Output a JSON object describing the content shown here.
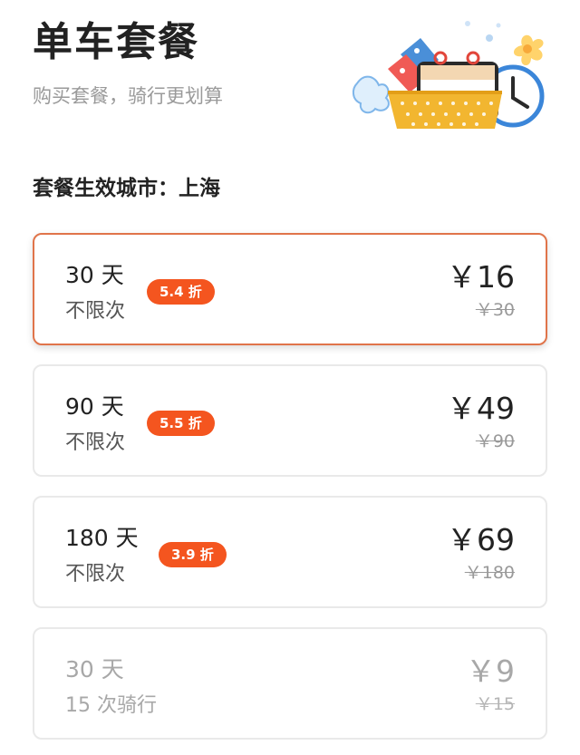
{
  "header": {
    "title": "单车套餐",
    "subtitle": "购买套餐，骑行更划算"
  },
  "hero": {
    "icon": "shopping-basket-calendar-clock-illustration"
  },
  "city": {
    "label": "套餐生效城市：上海"
  },
  "plans": [
    {
      "days": "30 天",
      "limit": "不限次",
      "discount": "5.4 折",
      "price": "￥16",
      "original_price": "￥30",
      "selected": true,
      "available": true
    },
    {
      "days": "90 天",
      "limit": "不限次",
      "discount": "5.5 折",
      "price": "￥49",
      "original_price": "￥90",
      "selected": false,
      "available": true
    },
    {
      "days": "180 天",
      "limit": "不限次",
      "discount": "3.9 折",
      "price": "￥69",
      "original_price": "￥180",
      "selected": false,
      "available": true
    },
    {
      "days": "30 天",
      "limit": "15 次骑行",
      "price": "￥9",
      "original_price": "￥15",
      "selected": false,
      "available": false
    }
  ],
  "colors": {
    "accent": "#f4551f",
    "selected_border": "#e0744a",
    "card_border": "#e9e9e9",
    "muted_text": "#9a9a9a",
    "disabled_text": "#a8a8a8"
  }
}
